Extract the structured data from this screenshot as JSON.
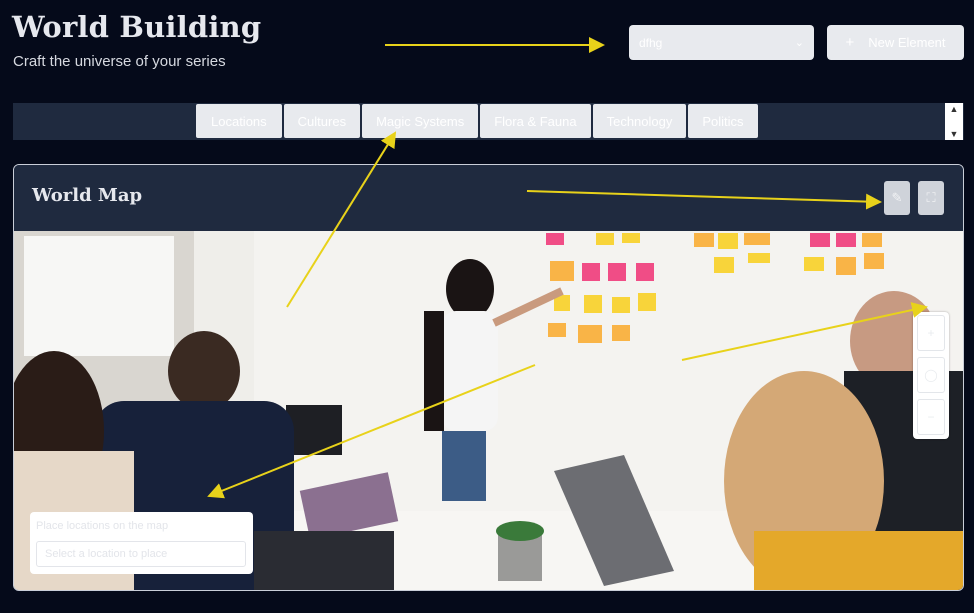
{
  "header": {
    "title": "World Building",
    "subtitle": "Craft the universe of your series"
  },
  "element_select": {
    "value": "dfhg",
    "icon": "chevron-down-icon"
  },
  "new_element_button": {
    "label": "New Element",
    "icon": "plus-icon"
  },
  "tabs": [
    {
      "label": "Locations"
    },
    {
      "label": "Cultures"
    },
    {
      "label": "Magic Systems"
    },
    {
      "label": "Flora & Fauna"
    },
    {
      "label": "Technology"
    },
    {
      "label": "Politics"
    }
  ],
  "map_card": {
    "title": "World Map",
    "edit_icon": "pencil-icon",
    "fullscreen_icon": "fullscreen-icon"
  },
  "zoom_controls": [
    "zoom-in-icon",
    "zoom-reset-icon",
    "zoom-out-icon"
  ],
  "place_panel": {
    "label": "Place locations on the map",
    "select_placeholder": "Select a location to place"
  },
  "colors": {
    "background": "#050a1a",
    "panel": "#1f2a3f",
    "annotation_arrow": "#e8d21a"
  }
}
